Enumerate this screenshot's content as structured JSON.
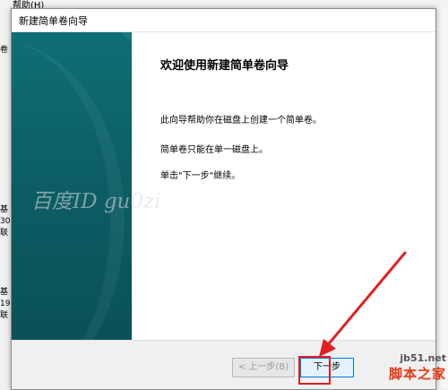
{
  "background": {
    "menu_help": "帮助(H)",
    "left_labels": [
      "卷",
      "基",
      "30",
      "联",
      "基",
      "19",
      "联"
    ]
  },
  "dialog": {
    "title": "新建简单卷向导",
    "heading": "欢迎使用新建简单卷向导",
    "paragraphs": [
      "此向导帮助你在磁盘上创建一个简单卷。",
      "简单卷只能在单一磁盘上。",
      "单击\"下一步\"继续。"
    ],
    "buttons": {
      "back": "< 上一步(B)",
      "next": "下一步"
    }
  },
  "watermark": {
    "text": "百度ID gu0zi"
  },
  "site_logo": {
    "url": "jb51.net",
    "name": "脚本之家"
  },
  "colors": {
    "side_panel": "#0c5e66",
    "highlight": "#e02020",
    "primary_button_border": "#0078d7"
  }
}
